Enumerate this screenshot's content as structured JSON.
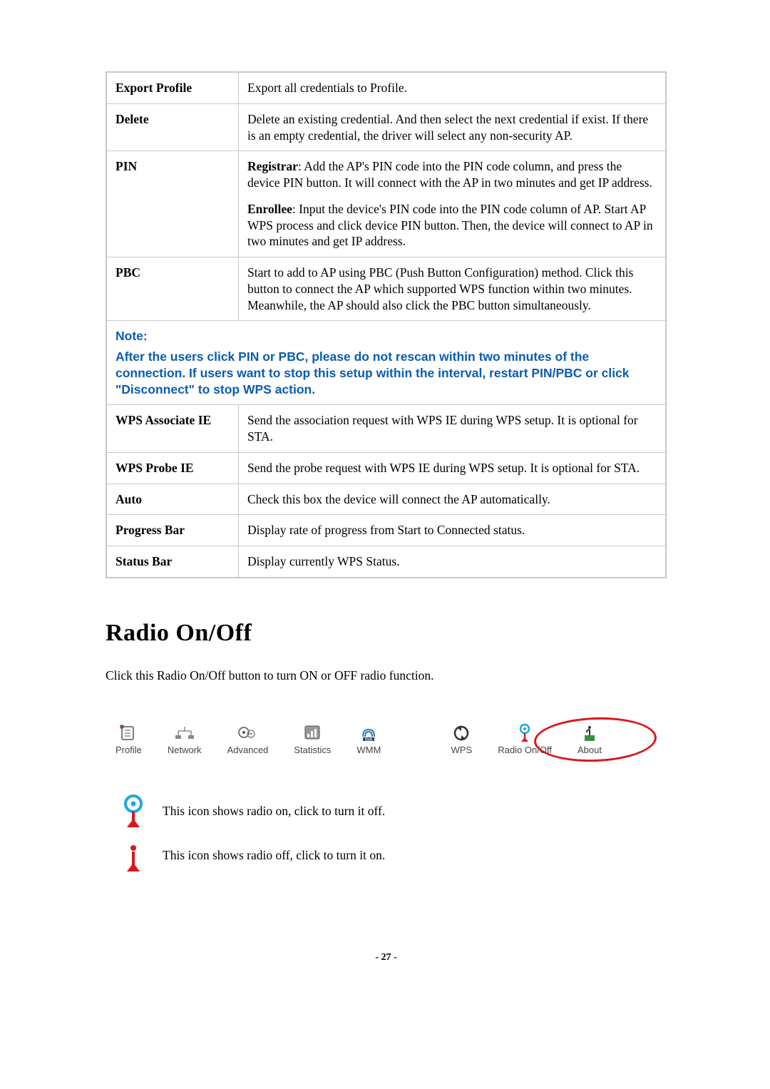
{
  "table": {
    "rows": [
      {
        "left": "Export Profile",
        "right": "Export all credentials to Profile."
      },
      {
        "left": "Delete",
        "right": "Delete an existing credential. And then select the next credential if exist. If there is an empty credential, the driver will select any non-security AP."
      },
      {
        "left": "PIN",
        "right_parts": {
          "p1_label": "Registrar",
          "p1_text": ": Add the AP's PIN code into the PIN code column, and press the device PIN button. It will connect with the AP in two minutes and get IP address.",
          "p2_label": "Enrollee",
          "p2_text": ": Input the device's PIN code into the PIN code column of AP. Start AP WPS process and click device PIN button. Then, the device will connect to AP in two minutes and get IP address."
        }
      },
      {
        "left": "PBC",
        "right": "Start to add to AP using PBC (Push Button Configuration) method. Click this button to connect the AP which supported WPS function within two minutes. Meanwhile, the AP should also click the PBC button simultaneously."
      }
    ],
    "note_label": "Note:",
    "note_text": "After the users click PIN or PBC, please do not rescan within two minutes of the connection. If users want to stop this setup within the interval, restart PIN/PBC or click \"Disconnect\" to stop WPS action.",
    "rows2": [
      {
        "left": "WPS Associate IE",
        "right": "Send the association request with WPS IE during WPS setup. It is optional for STA."
      },
      {
        "left": "WPS Probe IE",
        "right": "Send the probe request with WPS IE during WPS setup. It is optional for STA."
      },
      {
        "left": "Auto",
        "right": "Check this box the device will connect the AP automatically."
      },
      {
        "left": "Progress Bar",
        "right": "Display rate of progress from Start to Connected status."
      },
      {
        "left": "Status Bar",
        "right": "Display currently WPS Status."
      }
    ]
  },
  "heading": "Radio On/Off",
  "body": "Click this Radio On/Off button to turn ON or OFF radio function.",
  "toolbar": {
    "items": [
      "Profile",
      "Network",
      "Advanced",
      "Statistics",
      "WMM",
      "WPS",
      "Radio On/Off",
      "About"
    ]
  },
  "icon_lines": {
    "on": "This icon shows radio on, click to turn it off.",
    "off": "This icon shows radio off, click to turn it on."
  },
  "page_number": "- 27 -"
}
